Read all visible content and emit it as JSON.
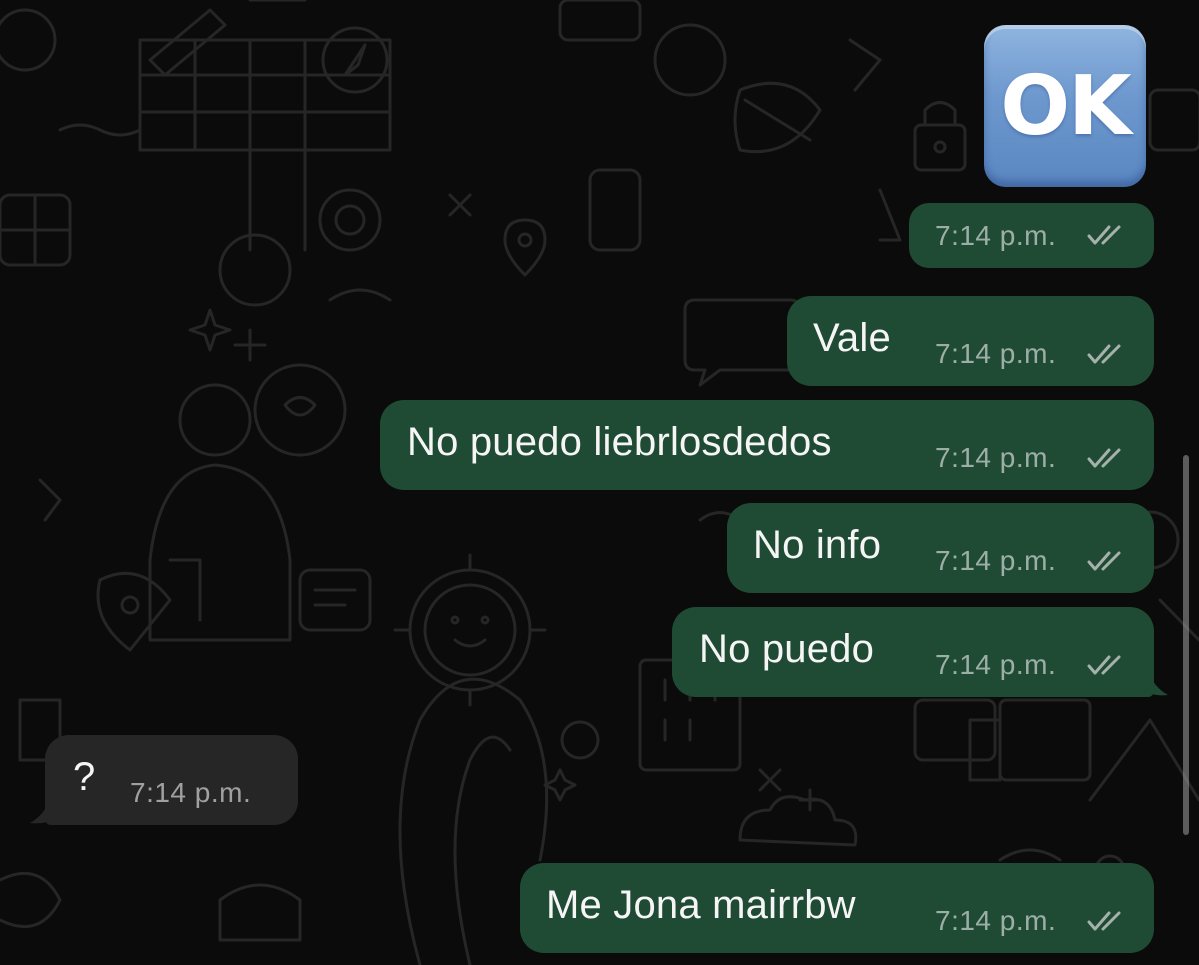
{
  "emoji": {
    "text": "OK",
    "name": "ok-button-emoji",
    "time": "7:14 p.m."
  },
  "messages": [
    {
      "text": "Vale",
      "time": "7:14 p.m.",
      "direction": "outgoing",
      "status": "read"
    },
    {
      "text": "No puedo liebrlosdedos",
      "time": "7:14 p.m.",
      "direction": "outgoing",
      "status": "read"
    },
    {
      "text": "No info",
      "time": "7:14 p.m.",
      "direction": "outgoing",
      "status": "read"
    },
    {
      "text": "No puedo",
      "time": "7:14 p.m.",
      "direction": "outgoing",
      "status": "read"
    },
    {
      "text": "?",
      "time": "7:14 p.m.",
      "direction": "incoming"
    },
    {
      "text": "Me Jona mairrbw",
      "time": "7:14 p.m.",
      "direction": "outgoing",
      "status": "read"
    }
  ],
  "icons": {
    "read_receipt": "double-check-icon"
  },
  "colors": {
    "background": "#0b0b0b",
    "outgoing_bubble": "#1f4b35",
    "incoming_bubble": "#262626",
    "text": "#f5f5f5",
    "timestamp": "#a8a8a8"
  }
}
